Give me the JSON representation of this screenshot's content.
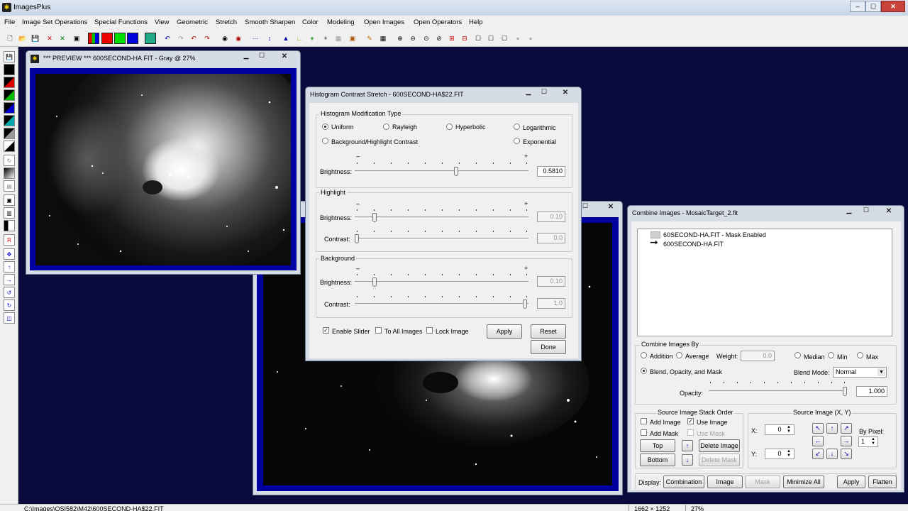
{
  "app": {
    "title": "ImagesPlus",
    "controls": [
      "–",
      "☐",
      "✕"
    ]
  },
  "menu": [
    "File",
    "Image Set Operations",
    "Special Functions",
    "View",
    "Geometric",
    "Stretch",
    "Smooth Sharpen",
    "Color",
    "Modeling",
    "Open Images",
    "Open Operators",
    "Help"
  ],
  "preview": {
    "title": "*** PREVIEW *** 600SECOND-HA.FIT - Gray @ 27%"
  },
  "hist": {
    "title": "Histogram Contrast Stretch - 600SECOND-HA$22.FIT",
    "type_group": "Histogram Modification Type",
    "types": {
      "uniform": "Uniform",
      "rayleigh": "Rayleigh",
      "hyperbolic": "Hyperbolic",
      "logarithmic": "Logarithmic",
      "bg_hl": "Background/Highlight Contrast",
      "exponential": "Exponential"
    },
    "selected_type": "Uniform",
    "minus": "–",
    "plus": "+",
    "brightness_label": "Brightness:",
    "contrast_label": "Contrast:",
    "brightness_value": "0.5810",
    "brightness_level": 0.581,
    "highlight_group": "Highlight",
    "hl_brightness": "0.10",
    "hl_contrast": "0.0",
    "background_group": "Background",
    "bg_brightness": "0.10",
    "bg_contrast": "1.0",
    "enable_slider": "Enable Slider",
    "to_all": "To All Images",
    "lock": "Lock Image",
    "apply": "Apply",
    "reset": "Reset",
    "done": "Done"
  },
  "combine": {
    "title": "Combine Images - MosaicTarget_2.fit",
    "tree": [
      "60SECOND-HA.FIT - Mask Enabled",
      "600SECOND-HA.FIT"
    ],
    "by_group": "Combine Images By",
    "addition": "Addition",
    "average": "Average",
    "weight_label": "Weight:",
    "weight": "0.0",
    "median": "Median",
    "min": "Min",
    "max": "Max",
    "blend": "Blend, Opacity, and Mask",
    "blend_mode_label": "Blend Mode:",
    "blend_mode": "Normal",
    "opacity_label": "Opacity:",
    "opacity": "1.000",
    "stack_group": "Source Image Stack Order",
    "add_image": "Add Image",
    "use_image": "Use Image",
    "add_mask": "Add Mask",
    "use_mask": "Use Mask",
    "top": "Top",
    "bottom": "Bottom",
    "delete_image": "Delete Image",
    "delete_mask": "Delete Mask",
    "xy_group": "Source Image (X, Y)",
    "x_label": "X:",
    "y_label": "Y:",
    "x": "0",
    "y": "0",
    "by_pixel": "By Pixel:",
    "pixel": "1",
    "display_label": "Display:",
    "combination": "Combination",
    "image": "Image",
    "mask": "Mask",
    "minimize_all": "Minimize All",
    "apply": "Apply",
    "flatten": "Flatten"
  },
  "status": {
    "path": "C:\\Images\\OSI582\\M42\\600SECOND-HA$22.FIT",
    "dims": "1662 × 1252",
    "zoom": "27%"
  }
}
